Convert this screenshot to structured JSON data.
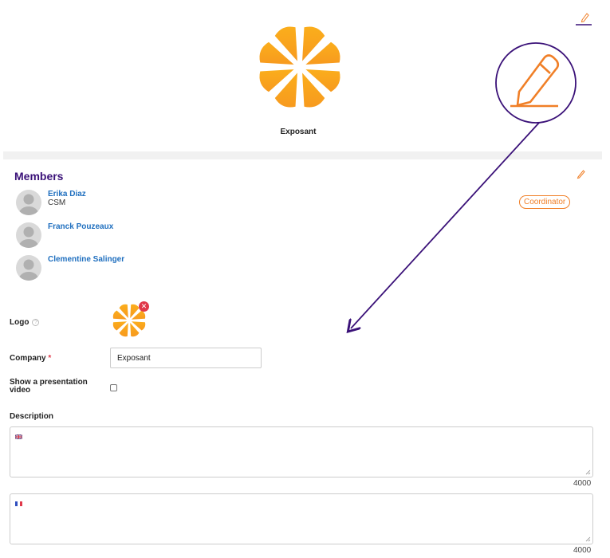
{
  "profile": {
    "company_name": "Exposant",
    "logo_icon": "orange-slice-icon",
    "edit_icon": "pencil-icon"
  },
  "members": {
    "title": "Members",
    "edit_icon": "pencil-icon",
    "list": [
      {
        "name": "Erika Diaz",
        "role": "CSM",
        "badge": "Coordinator"
      },
      {
        "name": "Franck Pouzeaux",
        "role": "",
        "badge": ""
      },
      {
        "name": "Clementine Salinger",
        "role": "",
        "badge": ""
      }
    ]
  },
  "callout": {
    "icon": "pencil-icon"
  },
  "form": {
    "logo_label": "Logo",
    "company_label": "Company",
    "company_required_mark": "*",
    "company_value": "Exposant",
    "video_label_line1": "Show a presentation",
    "video_label_line2": "video",
    "video_checked": false,
    "description_label": "Description",
    "description_fields": [
      {
        "flag": "uk-flag-icon",
        "value": "",
        "max_chars": "4000"
      },
      {
        "flag": "fr-flag-icon",
        "value": "",
        "max_chars": "4000"
      }
    ]
  },
  "colors": {
    "accent_purple": "#3a1178",
    "link_blue": "#1f6fbf",
    "orange": "#f07f27",
    "danger": "#e0394a"
  }
}
